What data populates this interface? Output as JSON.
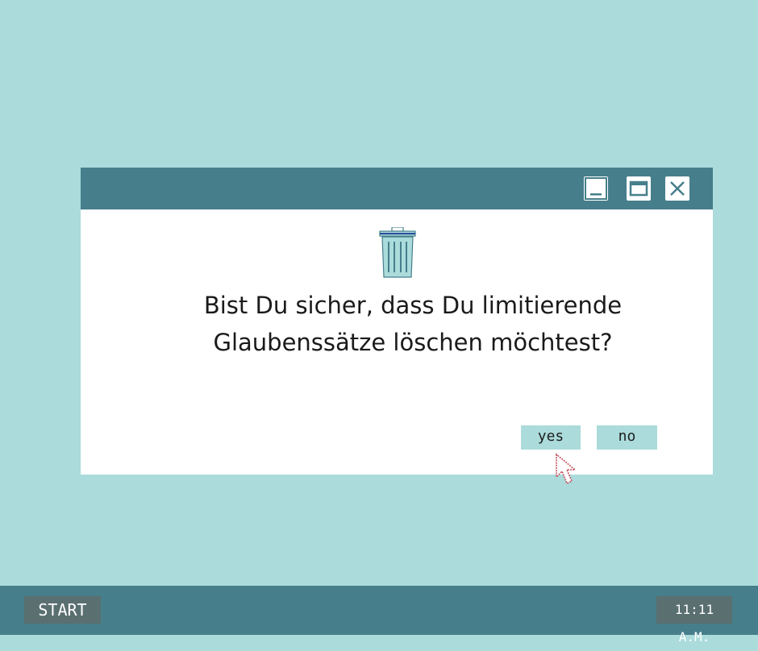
{
  "dialog": {
    "message": "Bist Du sicher, dass Du limitierende\nGlaubenssätze löschen möchtest?",
    "yes_label": "yes",
    "no_label": "no",
    "icon": "trash-icon"
  },
  "titlebar": {
    "buttons": [
      "minimize-icon",
      "maximize-icon",
      "close-icon"
    ]
  },
  "taskbar": {
    "start_label": "START",
    "clock": "11:11 A.M."
  },
  "colors": {
    "desktop": "#abdbdb",
    "titlebar": "#467f8b",
    "taskbar": "#467f8b",
    "taskbar_button": "#5a6f70",
    "dialog_button": "#abdbdb",
    "cursor_outline": "#c0505a"
  }
}
